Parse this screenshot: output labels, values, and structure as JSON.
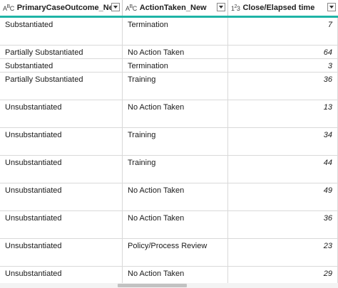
{
  "columns": [
    {
      "type_icon": "ABC",
      "label": "PrimaryCaseOutcome_New"
    },
    {
      "type_icon": "ABC",
      "label": "ActionTaken_New"
    },
    {
      "type_icon": "123",
      "label": "Close/Elapsed time"
    }
  ],
  "rows": [
    {
      "outcome": "Substantiated",
      "action": "Termination",
      "elapsed": "7"
    },
    {
      "outcome": "Partially Substantiated",
      "action": "No Action Taken",
      "elapsed": "64"
    },
    {
      "outcome": "Substantiated",
      "action": "Termination",
      "elapsed": "3"
    },
    {
      "outcome": "Partially Substantiated",
      "action": "Training",
      "elapsed": "36"
    },
    {
      "outcome": "Unsubstantiated",
      "action": "No Action Taken",
      "elapsed": "13"
    },
    {
      "outcome": "Unsubstantiated",
      "action": "Training",
      "elapsed": "34"
    },
    {
      "outcome": "Unsubstantiated",
      "action": "Training",
      "elapsed": "44"
    },
    {
      "outcome": "Unsubstantiated",
      "action": "No Action Taken",
      "elapsed": "49"
    },
    {
      "outcome": "Unsubstantiated",
      "action": "No Action Taken",
      "elapsed": "36"
    },
    {
      "outcome": "Unsubstantiated",
      "action": "Policy/Process Review",
      "elapsed": "23"
    },
    {
      "outcome": "Unsubstantiated",
      "action": "No Action Taken",
      "elapsed": "29"
    }
  ],
  "colors": {
    "header_accent": "#1fb4a6",
    "grid_line": "#d9d9d9"
  }
}
